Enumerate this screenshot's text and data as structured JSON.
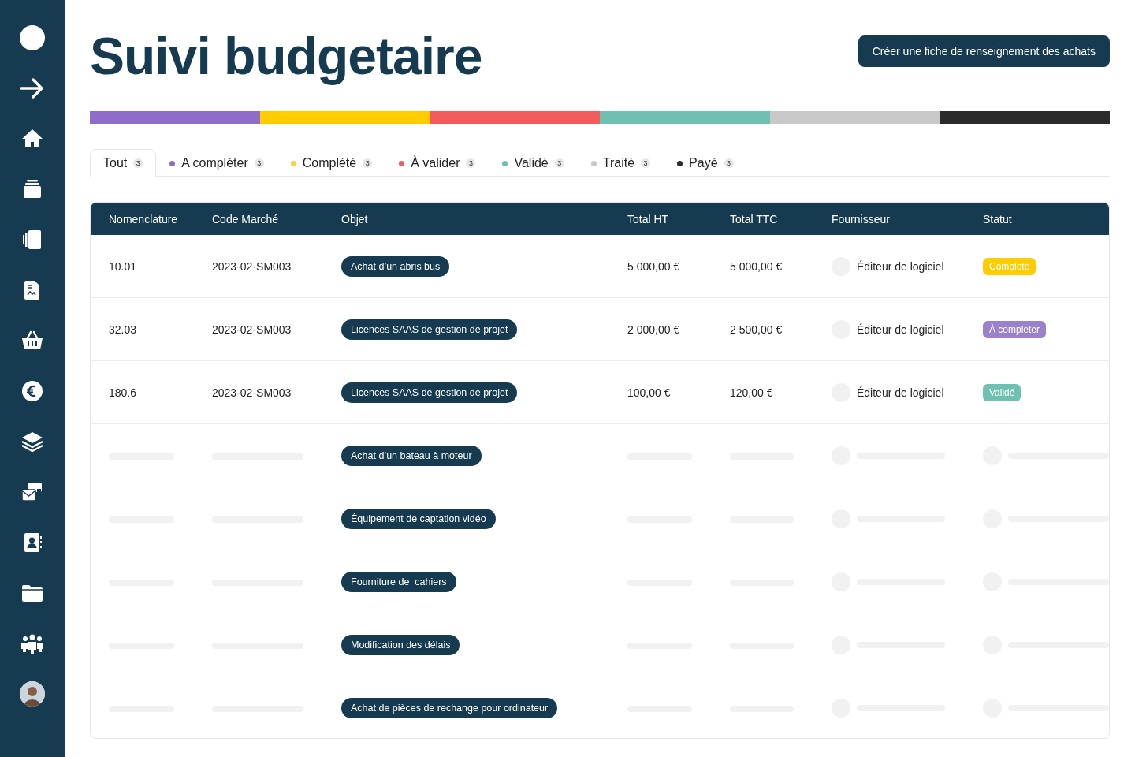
{
  "title": "Suivi budgetaire",
  "action_button": "Créer une fiche de renseignement des achats",
  "status_bar": [
    {
      "color": "#8e6cc9"
    },
    {
      "color": "#ffcc00"
    },
    {
      "color": "#f25c5c"
    },
    {
      "color": "#6fc0b0"
    },
    {
      "color": "#c8c8c8"
    },
    {
      "color": "#2b2b2b"
    }
  ],
  "tabs": [
    {
      "label": "Tout",
      "count": "3",
      "selected": true
    },
    {
      "label": "A compléter",
      "count": "3",
      "selected": false,
      "color": "#8e6cc9"
    },
    {
      "label": "Complété",
      "count": "3",
      "selected": false,
      "color": "#ffcc44"
    },
    {
      "label": "À valider",
      "count": "3",
      "selected": false,
      "color": "#f25c5c"
    },
    {
      "label": "Validé",
      "count": "3",
      "selected": false,
      "color": "#6fc0b0"
    },
    {
      "label": "Traité",
      "count": "3",
      "selected": false,
      "color": "#c8c8c8"
    },
    {
      "label": "Payé",
      "count": "3",
      "selected": false,
      "color": "#2b2b2b"
    }
  ],
  "table": {
    "columns": [
      "Nomenclature",
      "Code Marché",
      "Objet",
      "Total HT",
      "Total TTC",
      "Fournisseur",
      "Statut"
    ],
    "rows": [
      {
        "kind": "full",
        "nomenclature": "10.01",
        "code": "2023-02-SM003",
        "objet": "Achat d’un abris bus",
        "total_ht": "5 000,00 €",
        "total_ttc": "5 000,00 €",
        "fournisseur": "Éditeur de logiciel",
        "statut": "Completé",
        "color": "#ffcc00",
        "divider_below": true
      },
      {
        "kind": "full",
        "nomenclature": "32.03",
        "code": "2023-02-SM003",
        "objet": "Licences SAAS de gestion de projet",
        "total_ht": "2 000,00 €",
        "total_ttc": "2 500,00 €",
        "fournisseur": "Éditeur de logiciel",
        "statut": "À completer",
        "color": "#9b80cc",
        "divider_below": true
      },
      {
        "kind": "full",
        "nomenclature": "180.6",
        "code": "2023-02-SM003",
        "objet": "Licences SAAS de gestion de projet",
        "total_ht": "100,00 €",
        "total_ttc": "120,00 €",
        "fournisseur": "Éditeur de logiciel",
        "statut": "Validé",
        "color": "#6fc0b0",
        "divider_below": true
      },
      {
        "kind": "placeholder",
        "objet": "Achat d’un bateau à moteur",
        "divider_below": true
      },
      {
        "kind": "placeholder",
        "objet": "Équipement de captation vidéo",
        "divider_below": false
      },
      {
        "kind": "placeholder",
        "objet": "Fourniture de  cahiers",
        "divider_below": true
      },
      {
        "kind": "placeholder",
        "objet": "Modification des délais",
        "divider_below": false
      },
      {
        "kind": "placeholder",
        "objet": "Achat de pièces de rechange pour ordinateur",
        "divider_below": false
      }
    ]
  }
}
